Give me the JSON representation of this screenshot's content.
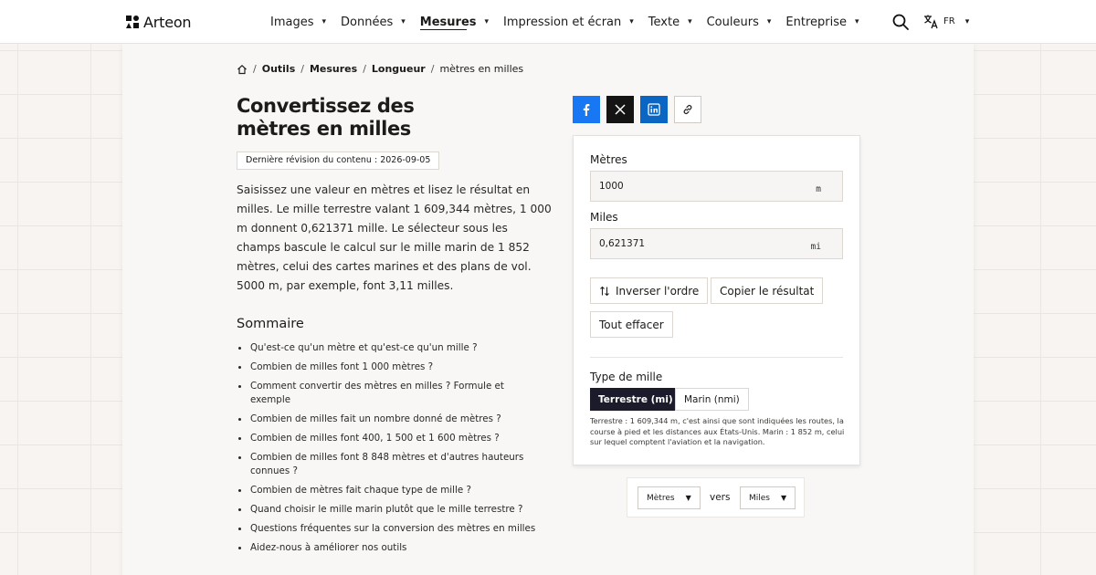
{
  "header": {
    "brand": "Arteon",
    "nav": [
      {
        "label": "Images",
        "active": false
      },
      {
        "label": "Données",
        "active": false
      },
      {
        "label": "Mesures",
        "active": true
      },
      {
        "label": "Impression et écran",
        "active": false
      },
      {
        "label": "Texte",
        "active": false
      },
      {
        "label": "Couleurs",
        "active": false
      },
      {
        "label": "Entreprise",
        "active": false
      }
    ],
    "chevron": "▾",
    "language": "FR",
    "icons": {
      "search": "search-icon",
      "language": "translate-icon",
      "home": "home-icon"
    }
  },
  "breadcrumb": {
    "items": [
      "Outils",
      "Mesures",
      "Longueur"
    ],
    "current": "mètres en milles",
    "separator": "/"
  },
  "page": {
    "title_line1": "Convertissez des",
    "title_line2": "mètres en milles",
    "revision": "Dernière révision du contenu : 2026-09-05",
    "intro": "Saisissez une valeur en mètres et lisez le résultat en milles. Le mille terrestre valant 1 609,344 mètres, 1 000 m donnent 0,621371 mille. Le sélecteur sous les champs bascule le calcul sur le mille marin de 1 852 mètres, celui des cartes marines et des plans de vol. 5000 m, par exemple, font 3,11 milles."
  },
  "toc": {
    "title": "Sommaire",
    "items": [
      "Qu'est-ce qu'un mètre et qu'est-ce qu'un mille ?",
      "Combien de milles font 1 000 mètres ?",
      "Comment convertir des mètres en milles ? Formule et exemple",
      "Combien de milles fait un nombre donné de mètres ?",
      "Combien de milles font 400, 1 500 et 1 600 mètres ?",
      "Combien de milles font 8 848 mètres et d'autres hauteurs connues ?",
      "Combien de mètres fait chaque type de mille ?",
      "Quand choisir le mille marin plutôt que le mille terrestre ?",
      "Questions fréquentes sur la conversion des mètres en milles",
      "Aidez-nous à améliorer nos outils"
    ]
  },
  "share": {
    "icons": [
      "facebook-icon",
      "x-icon",
      "linkedin-icon",
      "link-icon"
    ],
    "colors": {
      "facebook": "#1877f2",
      "x": "#141414",
      "linkedin": "#0a66c2"
    }
  },
  "converter": {
    "from_label": "Mètres",
    "from_value": "1000",
    "from_unit": "m",
    "to_label": "Miles",
    "to_value": "0,621371",
    "to_unit": "mi",
    "swap_button": "Inverser l'ordre",
    "copy_button": "Copier le résultat",
    "clear_button": "Tout effacer",
    "mile_type_label": "Type de mille",
    "mile_options": [
      {
        "label": "Terrestre (mi)",
        "selected": true
      },
      {
        "label": "Marin (nmi)",
        "selected": false
      }
    ],
    "note": "Terrestre : 1 609,344 m, c'est ainsi que sont indiquées les routes, la course à pied et les distances aux États-Unis. Marin : 1 852 m, celui sur lequel comptent l'aviation et la navigation.",
    "accent_color": "#1b1b2b"
  },
  "selector": {
    "from": "Mètres",
    "connector": "vers",
    "to": "Miles",
    "chevron": "▼"
  }
}
